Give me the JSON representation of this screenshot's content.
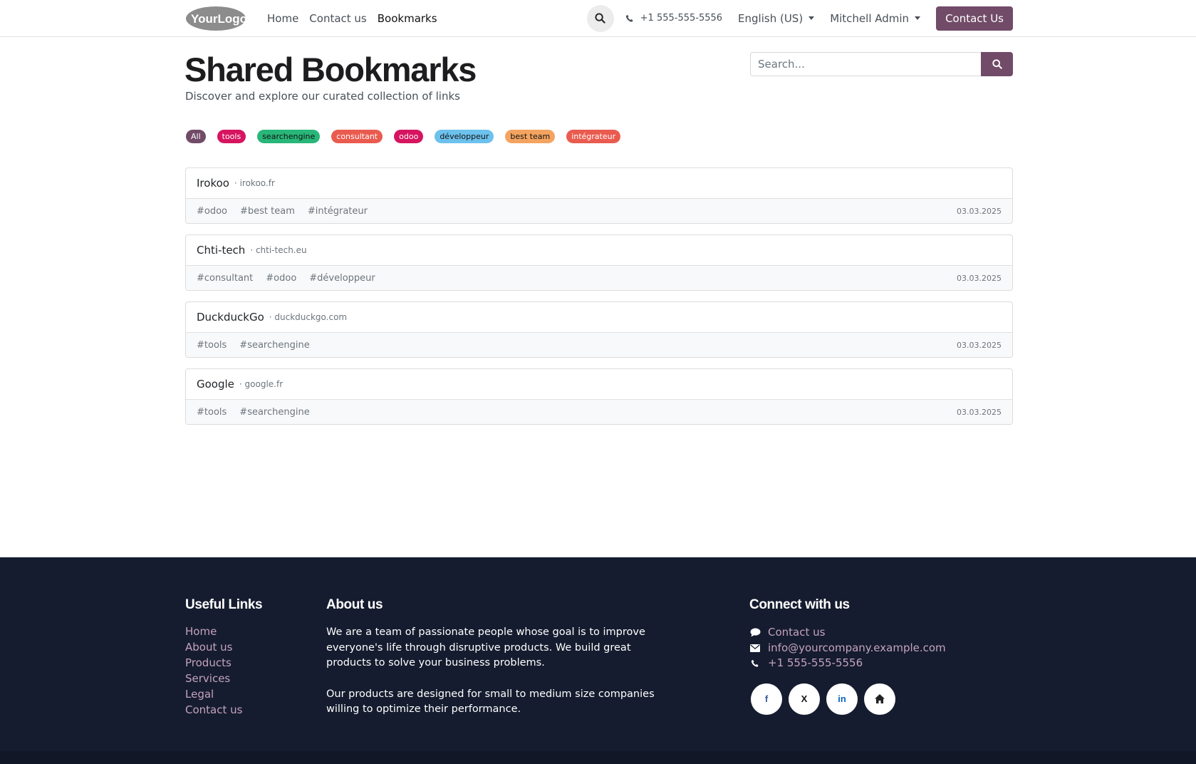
{
  "header": {
    "logo_text": "YourLogo",
    "nav": [
      {
        "label": "Home"
      },
      {
        "label": "Contact us"
      },
      {
        "label": "Bookmarks",
        "active": true
      }
    ],
    "phone": "+1 555-555-5556",
    "language": "English (US)",
    "user": "Mitchell Admin",
    "cta_label": "Contact Us"
  },
  "page": {
    "title": "Shared Bookmarks",
    "subtitle": "Discover and explore our curated collection of links",
    "search_placeholder": "Search..."
  },
  "tags": [
    {
      "label": "All",
      "color": "#714b67"
    },
    {
      "label": "tools",
      "color": "#d6145f"
    },
    {
      "label": "searchengine",
      "color": "#28b779"
    },
    {
      "label": "consultant",
      "color": "#ea5b4f"
    },
    {
      "label": "odoo",
      "color": "#d6145f"
    },
    {
      "label": "développeur",
      "color": "#6cc1ed"
    },
    {
      "label": "best team",
      "color": "#f4a460"
    },
    {
      "label": "intégrateur",
      "color": "#ea5b4f"
    }
  ],
  "bookmarks": [
    {
      "title": "Irokoo",
      "domain": "· irokoo.fr",
      "tags": [
        "#odoo",
        "#best team",
        "#intégrateur"
      ],
      "date": "03.03.2025"
    },
    {
      "title": "Chti-tech",
      "domain": "· chti-tech.eu",
      "tags": [
        "#consultant",
        "#odoo",
        "#développeur"
      ],
      "date": "03.03.2025"
    },
    {
      "title": "DuckduckGo",
      "domain": "· duckduckgo.com",
      "tags": [
        "#tools",
        "#searchengine"
      ],
      "date": "03.03.2025"
    },
    {
      "title": "Google",
      "domain": "· google.fr",
      "tags": [
        "#tools",
        "#searchengine"
      ],
      "date": "03.03.2025"
    }
  ],
  "footer": {
    "useful_links_title": "Useful Links",
    "useful_links": [
      "Home",
      "About us",
      "Products",
      "Services",
      "Legal",
      "Contact us"
    ],
    "about_title": "About us",
    "about_p1": "We are a team of passionate people whose goal is to improve everyone's life through disruptive products. We build great products to solve your business problems.",
    "about_p2": "Our products are designed for small to medium size companies willing to optimize their performance.",
    "connect_title": "Connect with us",
    "connect_contact": "Contact us",
    "connect_email": "info@yourcompany.example.com",
    "connect_phone": "+1 555-555-5556",
    "socials": [
      {
        "icon": "facebook-icon",
        "glyph": "f",
        "color": "#3b5998"
      },
      {
        "icon": "x-twitter-icon",
        "glyph": "X",
        "color": "#111111"
      },
      {
        "icon": "linkedin-icon",
        "glyph": "in",
        "color": "#0a66c2"
      },
      {
        "icon": "home-icon",
        "glyph": "",
        "color": "#222222"
      }
    ]
  }
}
